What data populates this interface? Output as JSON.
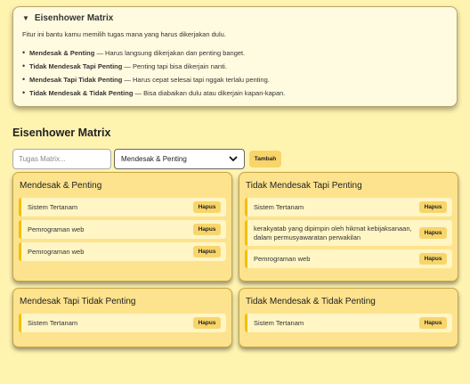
{
  "info": {
    "summary": "Eisenhower Matrix",
    "description": "Fitur ini bantu kamu memilih tugas mana yang harus dikerjakan dulu.",
    "items": [
      {
        "term": "Mendesak & Penting",
        "text": " — Harus langsung dikerjakan dan penting banget."
      },
      {
        "term": "Tidak Mendesak Tapi Penting",
        "text": " — Penting tapi bisa dikerjain nanti."
      },
      {
        "term": "Mendesak Tapi Tidak Penting",
        "text": " — Harus cepat selesai tapi nggak terlalu penting."
      },
      {
        "term": "Tidak Mendesak & Tidak Penting",
        "text": " — Bisa diabaikan dulu atau dikerjain kapan-kapan."
      }
    ]
  },
  "heading": "Eisenhower Matrix",
  "form": {
    "placeholder": "Tugas Matrix...",
    "selected": "Mendesak & Penting",
    "add_label": "Tambah"
  },
  "quadrants": [
    {
      "title": "Mendesak & Penting",
      "tasks": [
        "Sistem Tertanam",
        "Pemrograman web",
        "Pemrograman web"
      ]
    },
    {
      "title": "Tidak Mendesak Tapi Penting",
      "tasks": [
        "Sistem Tertanam",
        "kerakyatab yang dipimpin oleh hikmat kebijaksanaan, dalam permusyawaratan perwakilan",
        "Pemrograman web"
      ]
    },
    {
      "title": "Mendesak Tapi Tidak Penting",
      "tasks": [
        "Sistem Tertanam"
      ]
    },
    {
      "title": "Tidak Mendesak & Tidak Penting",
      "tasks": [
        "Sistem Tertanam"
      ]
    }
  ],
  "delete_label": "Hapus",
  "colors": {
    "background": "#fff3b0",
    "quadrant": "#fde38d",
    "accent": "#f2c000",
    "button": "#f8d56b"
  }
}
